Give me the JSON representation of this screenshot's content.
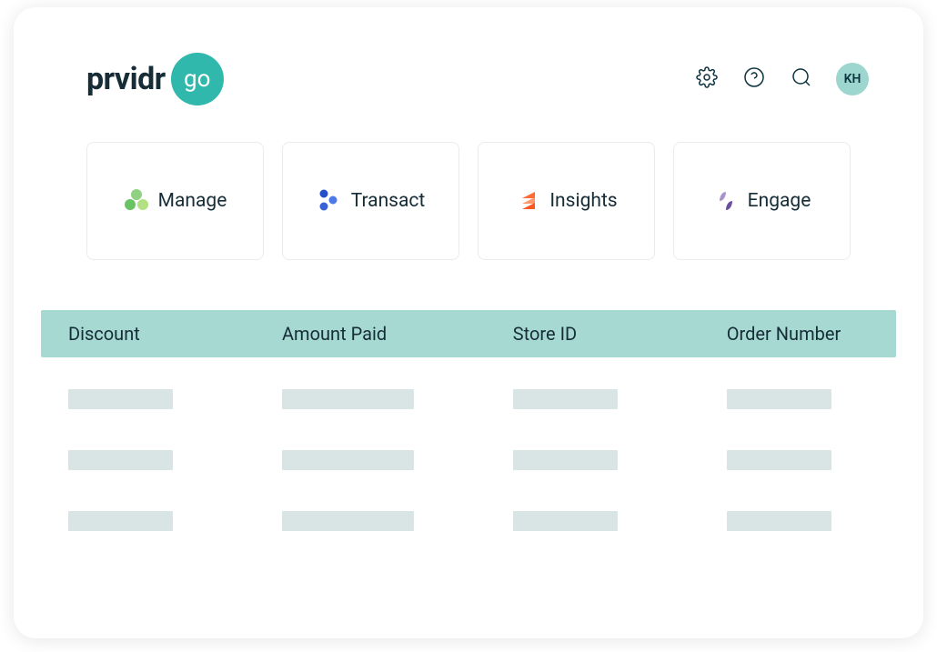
{
  "header": {
    "logo_text": "prvidr",
    "logo_badge": "go",
    "avatar_initials": "KH"
  },
  "nav": {
    "cards": [
      {
        "label": "Manage",
        "icon": "manage"
      },
      {
        "label": "Transact",
        "icon": "transact"
      },
      {
        "label": "Insights",
        "icon": "insights"
      },
      {
        "label": "Engage",
        "icon": "engage"
      }
    ]
  },
  "table": {
    "columns": [
      "Discount",
      "Amount Paid",
      "Store ID",
      "Order Number"
    ],
    "row_count": 3
  },
  "colors": {
    "teal": "#2fb8ab",
    "header_bg": "#a6d9d2",
    "placeholder": "#d9e5e4",
    "text": "#162d38"
  }
}
